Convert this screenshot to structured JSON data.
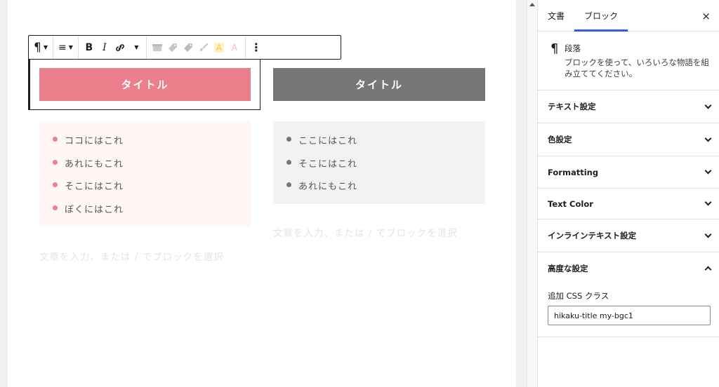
{
  "toolbar": {
    "paragraph_icon": "¶",
    "align_icon": "≡",
    "bold_label": "B",
    "italic_label": "I",
    "link_icon": "🔗",
    "highlight_label": "A",
    "text_color_label": "A",
    "more_icon": "⋮"
  },
  "content": {
    "left": {
      "title": "タイトル",
      "items": [
        "ココにはこれ",
        "あれにもこれ",
        "そこにはこれ",
        "ぼくにはこれ"
      ],
      "placeholder": "文章を入力、または / でブロックを選択"
    },
    "right": {
      "title": "タイトル",
      "items": [
        "ここにはこれ",
        "そこにはこれ",
        "あれにもこれ"
      ],
      "placeholder": "文章を入力、または / でブロックを選択"
    }
  },
  "colors": {
    "pink_title": "#ec7f8c",
    "gray_title": "#777777",
    "pink_bg": "#fff6f6",
    "gray_bg": "#f2f2f2",
    "accent": "#3858e9"
  },
  "sidebar": {
    "tabs": [
      "文書",
      "ブロック"
    ],
    "active_tab": "ブロック",
    "close_icon": "×",
    "block": {
      "icon": "¶",
      "name": "段落",
      "description": "ブロックを使って、いろいろな物語を組み立ててください。"
    },
    "panels": [
      {
        "title": "テキスト設定",
        "state": "collapsed"
      },
      {
        "title": "色設定",
        "state": "collapsed"
      },
      {
        "title": "Formatting",
        "state": "collapsed"
      },
      {
        "title": "Text Color",
        "state": "collapsed"
      },
      {
        "title": "インラインテキスト設定",
        "state": "collapsed"
      },
      {
        "title": "高度な設定",
        "state": "expanded"
      }
    ],
    "advanced": {
      "css_label": "追加 CSS クラス",
      "css_value": "hikaku-title my-bgc1"
    }
  }
}
